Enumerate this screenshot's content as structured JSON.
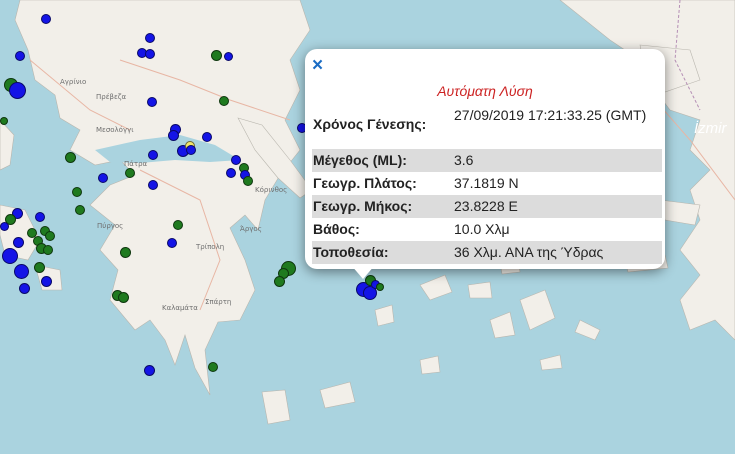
{
  "map": {
    "labels": [
      {
        "text": "Πρέβεζα",
        "name": "place-preveza"
      },
      {
        "text": "Μεσολόγγι",
        "name": "place-mesologgi"
      },
      {
        "text": "Πάτρα",
        "name": "place-patra"
      },
      {
        "text": "Πύργος",
        "name": "place-pyrgos"
      },
      {
        "text": "Τρίπολη",
        "name": "place-tripoli"
      },
      {
        "text": "Άργος",
        "name": "place-argos"
      },
      {
        "text": "Σπάρτη",
        "name": "place-sparti"
      },
      {
        "text": "Καλαμάτα",
        "name": "place-kalamata"
      },
      {
        "text": "Κόρινθος",
        "name": "place-korinthos"
      },
      {
        "text": "Αγρίνιο",
        "name": "place-agrinio"
      }
    ],
    "city_label": "İzmir",
    "colors": {
      "sea": "#aad3df",
      "land": "#f2efe9",
      "marker_blue": "#1414e6",
      "marker_green": "#1f7a1f"
    }
  },
  "popup": {
    "close_label": "×",
    "title": "Αυτόματη Λύση",
    "rows": [
      {
        "key": "Χρόνος Γένεσης:",
        "value": "27/09/2019 17:21:33.25 (GMT)"
      },
      {
        "key": "Μέγεθος (ML):",
        "value": "3.6"
      },
      {
        "key": "Γεωγρ. Πλάτος:",
        "value": "37.1819 N"
      },
      {
        "key": "Γεωγρ. Μήκος:",
        "value": "23.8228 E"
      },
      {
        "key": "Βάθος:",
        "value": "10.0 Χλμ"
      },
      {
        "key": "Τοποθεσία:",
        "value": "36 Χλμ. ΑΝΑ της Ύδρας"
      }
    ]
  }
}
